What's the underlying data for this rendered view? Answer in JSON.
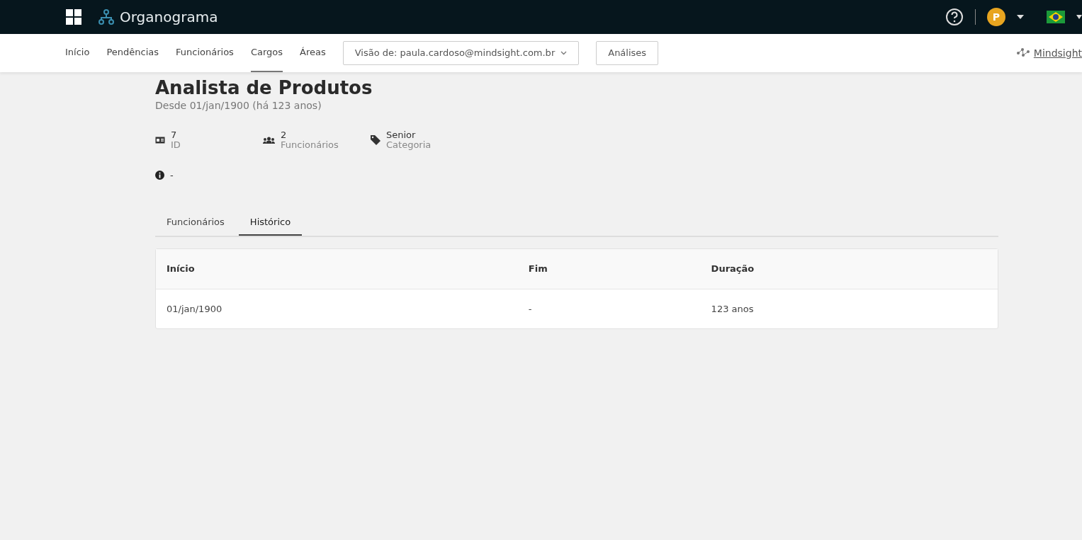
{
  "app_title": "Organograma",
  "user_avatar": "P",
  "nav": [
    {
      "label": "Início",
      "selected": false
    },
    {
      "label": "Pendências",
      "selected": false
    },
    {
      "label": "Funcionários",
      "selected": false
    },
    {
      "label": "Cargos",
      "selected": true
    },
    {
      "label": "Áreas",
      "selected": false
    }
  ],
  "view_select": "Visão de: paula.cardoso@mindsight.com.br",
  "analyses_button": "Análises",
  "brand": "Mindsight",
  "title": "Analista de Produtos",
  "subtitle": "Desde 01/jan/1900 (há 123 anos)",
  "stats": [
    {
      "kind": "id",
      "value": "7",
      "label": "ID"
    },
    {
      "kind": "people",
      "value": "2",
      "label": "Funcionários"
    },
    {
      "kind": "tag",
      "value": "Senior",
      "label": "Categoria"
    }
  ],
  "info": "-",
  "tabs": [
    {
      "label": "Funcionários",
      "selected": false
    },
    {
      "label": "Histórico",
      "selected": true
    }
  ],
  "table": {
    "columns": [
      "Início",
      "Fim",
      "Duração"
    ],
    "rows": [
      [
        "01/jan/1900",
        "-",
        "123 anos"
      ]
    ]
  }
}
